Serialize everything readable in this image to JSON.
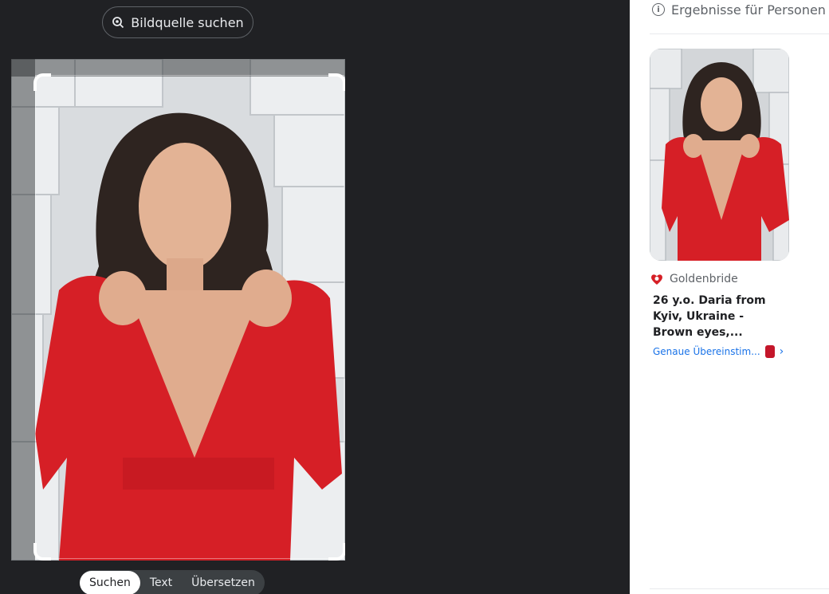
{
  "toolbar": {
    "source_button_label": "Bildquelle suchen"
  },
  "modes": [
    {
      "label": "Suchen",
      "active": true
    },
    {
      "label": "Text",
      "active": false
    },
    {
      "label": "Übersetzen",
      "active": false
    }
  ],
  "results": {
    "header": "Ergebnisse für Personen s",
    "items": [
      {
        "source": "Goldenbride",
        "title": "26 y.o. Daria from Kyiv, Ukraine - Brown eyes,...",
        "match_label": "Genaue Übereinstim..."
      }
    ]
  },
  "colors": {
    "accent": "#1a73e8",
    "dress": "#d61f26",
    "dark_bg": "#202124"
  }
}
